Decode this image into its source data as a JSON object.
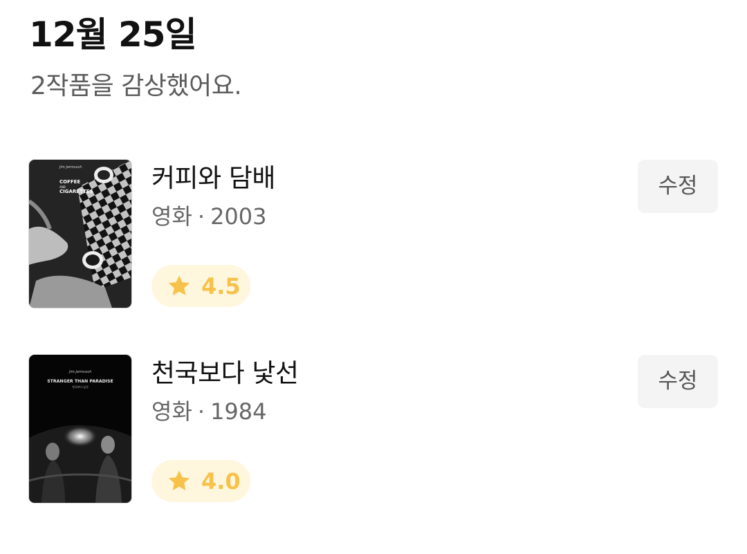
{
  "header": {
    "date": "12월 25일",
    "summary": "2작품을 감상했어요."
  },
  "items": [
    {
      "title": "커피와 담배",
      "category": "영화",
      "year": "2003",
      "rating": "4.5",
      "edit_label": "수정",
      "poster": {
        "signature": "Jim Jarmusch",
        "title_line1": "COFFEE",
        "title_line2": "AND",
        "title_line3": "CIGARETTES"
      }
    },
    {
      "title": "천국보다 낯선",
      "category": "영화",
      "year": "1984",
      "rating": "4.0",
      "edit_label": "수정",
      "poster": {
        "signature": "Jim Jarmusch",
        "title": "STRANGER THAN PARADISE",
        "subtitle": "천국보다 낯선"
      }
    }
  ],
  "colors": {
    "star": "#f7c24a",
    "rating_bg": "#fff6de",
    "button_bg": "#f4f4f4"
  },
  "icons": {
    "rating": "star-icon",
    "separator": "·"
  }
}
